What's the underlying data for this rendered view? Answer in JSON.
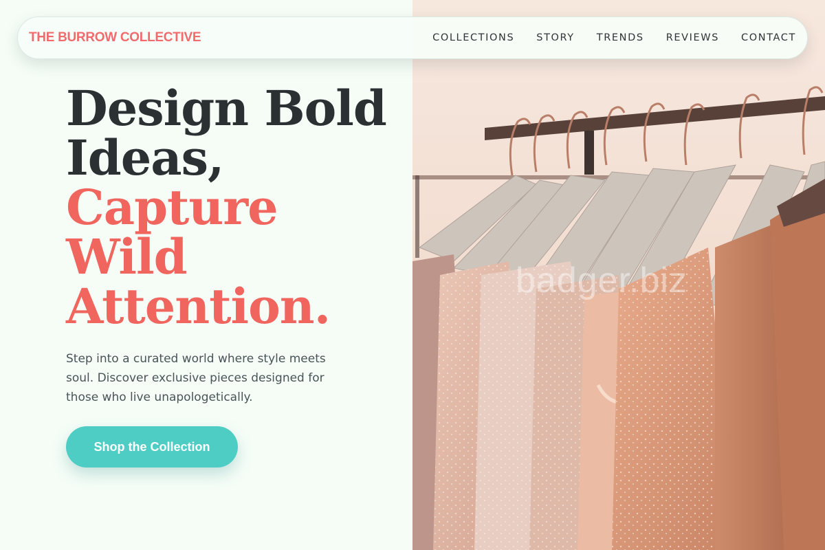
{
  "nav": {
    "brand": "THE BURROW COLLECTIVE",
    "links": [
      "COLLECTIONS",
      "STORY",
      "TRENDS",
      "REVIEWS",
      "CONTACT"
    ]
  },
  "hero": {
    "line1": "Design Bold",
    "line2": "Ideas,",
    "line3": "Capture",
    "line4": "Wild",
    "line5": "Attention.",
    "subtitle": "Step into a curated world where style meets soul. Discover exclusive pieces designed for those who live unapologetically.",
    "cta_label": "Shop the Collection"
  },
  "photo": {
    "watermark": "badger.biz",
    "icon": "clothing-rack-photo"
  },
  "colors": {
    "background": "#f6fdf7",
    "brand": "#f06b6b",
    "accent": "#f0665f",
    "heading": "#2b3133",
    "button": "#4ecdc4"
  }
}
